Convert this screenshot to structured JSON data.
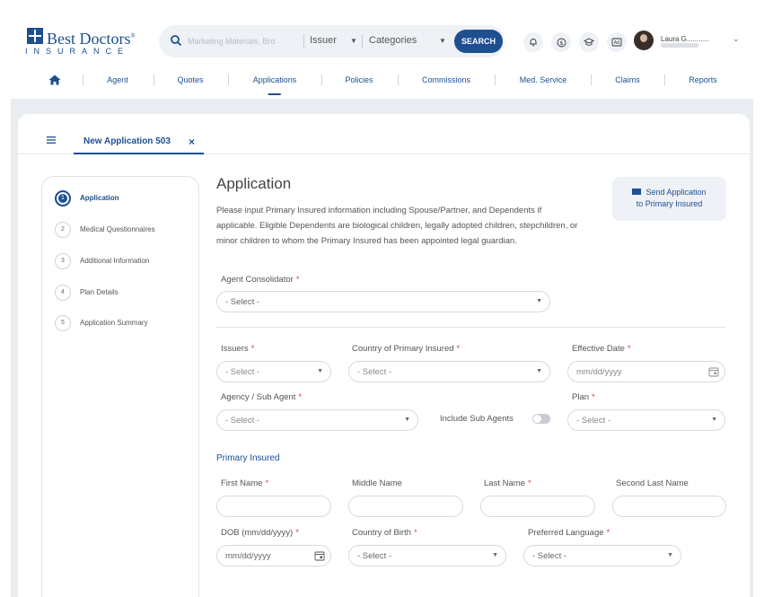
{
  "brand": {
    "name": "Best Doctors",
    "registered": "®",
    "sub": "INSURANCE"
  },
  "search": {
    "placeholder": "Marketing Materials, Brochur",
    "issuer_label": "Issuer",
    "categories_label": "Categories",
    "button_label": "SEARCH"
  },
  "header_icons": [
    "bell-icon",
    "dollar-icon",
    "graduation-cap-icon",
    "ad-icon"
  ],
  "user": {
    "name": "Laura G..........."
  },
  "nav": {
    "items": [
      {
        "label": "Agent"
      },
      {
        "label": "Quotes"
      },
      {
        "label": "Applications",
        "active": true
      },
      {
        "label": "Policies"
      },
      {
        "label": "Commissions"
      },
      {
        "label": "Med. Service"
      },
      {
        "label": "Claims"
      },
      {
        "label": "Reports"
      }
    ]
  },
  "tab": {
    "title": "New Application 503",
    "close": "×"
  },
  "steps": [
    {
      "num": "1",
      "label": "Application",
      "active": true
    },
    {
      "num": "2",
      "label": "Medical Questionnaires"
    },
    {
      "num": "3",
      "label": "Additional Information"
    },
    {
      "num": "4",
      "label": "Plan Details"
    },
    {
      "num": "5",
      "label": "Application Summary"
    }
  ],
  "form": {
    "title": "Application",
    "description": "Please input Primary Insured information including Spouse/Partner, and Dependents if applicable. Eligible Dependents are biological children, legally adopted children, stepchildren, or minor children to whom the Primary Insured has been appointed legal guardian.",
    "send": {
      "line1": "Send Application",
      "line2": "to Primary Insured"
    },
    "select_placeholder": "- Select -",
    "date_placeholder": "mm/dd/yyyy",
    "required_mark": "*",
    "labels": {
      "agent_consolidator": "Agent Consolidator",
      "issuers": "Issuers",
      "country_primary": "Country of Primary Insured",
      "effective_date": "Effective Date",
      "agency": "Agency / Sub Agent",
      "include_sub_agents": "Include Sub Agents",
      "plan": "Plan",
      "first_name": "First Name",
      "middle_name": "Middle Name",
      "last_name": "Last Name",
      "second_last_name": "Second Last Name",
      "dob": "DOB (mm/dd/yyyy)",
      "country_birth": "Country of Birth",
      "preferred_language": "Preferred Language"
    },
    "section_primary": "Primary Insured"
  },
  "colors": {
    "brand": "#1d4f91",
    "required": "#d9453b",
    "backdrop": "#e9ecf1"
  }
}
